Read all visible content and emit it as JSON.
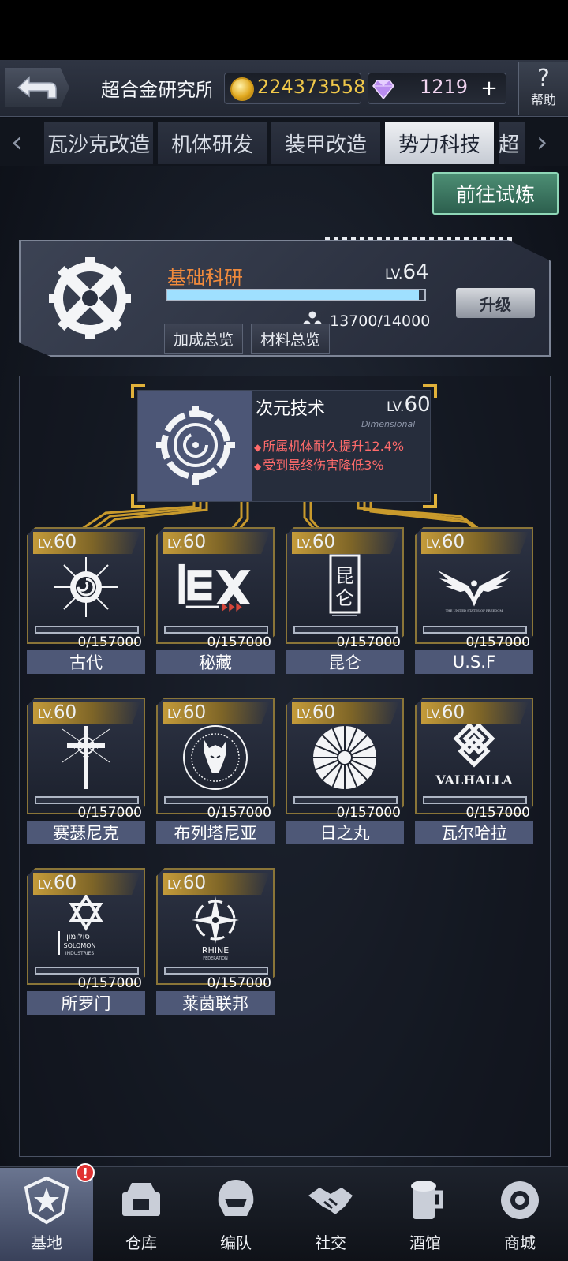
{
  "header": {
    "title": "超合金研究所",
    "coins": "224373558",
    "gems": "1219",
    "plus_label": "+",
    "help_label": "帮助",
    "help_icon": "?"
  },
  "tabs": [
    {
      "label": "瓦沙克改造",
      "active": false
    },
    {
      "label": "机体研发",
      "active": false
    },
    {
      "label": "装甲改造",
      "active": false
    },
    {
      "label": "势力科技",
      "active": true
    },
    {
      "label": "超",
      "active": false
    }
  ],
  "trial_button": "前往试炼",
  "base_research": {
    "title": "基础科研",
    "lv_label": "LV.",
    "level": "64",
    "progress_text": "13700/14000",
    "progress_fraction": 0.979,
    "bonus_overview": "加成总览",
    "material_overview": "材料总览",
    "upgrade": "升级"
  },
  "dimension_tech": {
    "title": "次元技术",
    "lv_label": "LV.",
    "level": "60",
    "subtitle": "Dimensional",
    "bonuses": [
      "所属机体耐久提升12.4%",
      "受到最终伤害降低3%"
    ]
  },
  "factions": [
    {
      "name": "古代",
      "lv_label": "LV.",
      "level": "60",
      "progress": "0/157000",
      "emblem": "ancient-sun-icon"
    },
    {
      "name": "秘藏",
      "lv_label": "LV.",
      "level": "60",
      "progress": "0/157000",
      "emblem": "ex-logo-icon"
    },
    {
      "name": "昆仑",
      "lv_label": "LV.",
      "level": "60",
      "progress": "0/157000",
      "emblem": "kunlun-seal-icon"
    },
    {
      "name": "U.S.F",
      "lv_label": "LV.",
      "level": "60",
      "progress": "0/157000",
      "emblem": "eagle-icon"
    },
    {
      "name": "赛瑟尼克",
      "lv_label": "LV.",
      "level": "60",
      "progress": "0/157000",
      "emblem": "cross-icon"
    },
    {
      "name": "布列塔尼亚",
      "lv_label": "LV.",
      "level": "60",
      "progress": "0/157000",
      "emblem": "wolf-seal-icon"
    },
    {
      "name": "日之丸",
      "lv_label": "LV.",
      "level": "60",
      "progress": "0/157000",
      "emblem": "chrysanthemum-icon"
    },
    {
      "name": "瓦尔哈拉",
      "lv_label": "LV.",
      "level": "60",
      "progress": "0/157000",
      "emblem": "valhalla-knot-icon"
    },
    {
      "name": "所罗门",
      "lv_label": "LV.",
      "level": "60",
      "progress": "0/157000",
      "emblem": "star-of-david-icon"
    },
    {
      "name": "莱茵联邦",
      "lv_label": "LV.",
      "level": "60",
      "progress": "0/157000",
      "emblem": "compass-star-icon"
    }
  ],
  "emblem_text": {
    "kunlun": "昆仑",
    "usf": "THE UNITED STATES OF FREEDOM",
    "valhalla": "VALHALLA",
    "solomon_hebrew": "סולומון",
    "solomon": "SOLOMON",
    "solomon_sub": "INDUSTRIES",
    "rhine": "RHINE",
    "rhine_sub": "FEDERATION"
  },
  "bottom_nav": [
    {
      "label": "基地",
      "active": true,
      "icon": "base-star-icon"
    },
    {
      "label": "仓库",
      "active": false,
      "icon": "warehouse-icon"
    },
    {
      "label": "编队",
      "active": false,
      "icon": "formation-helmet-icon"
    },
    {
      "label": "社交",
      "active": false,
      "icon": "handshake-icon"
    },
    {
      "label": "酒馆",
      "active": false,
      "icon": "tavern-icon"
    },
    {
      "label": "商城",
      "active": false,
      "icon": "shop-icon"
    }
  ],
  "alert_badge": "!",
  "colors": {
    "accent_orange": "#f08a3c",
    "bonus_red": "#ff6b6b",
    "coin_gold": "#f0c84a",
    "frame_gold": "#c49b3a",
    "trial_green": "#2c5f4e"
  }
}
